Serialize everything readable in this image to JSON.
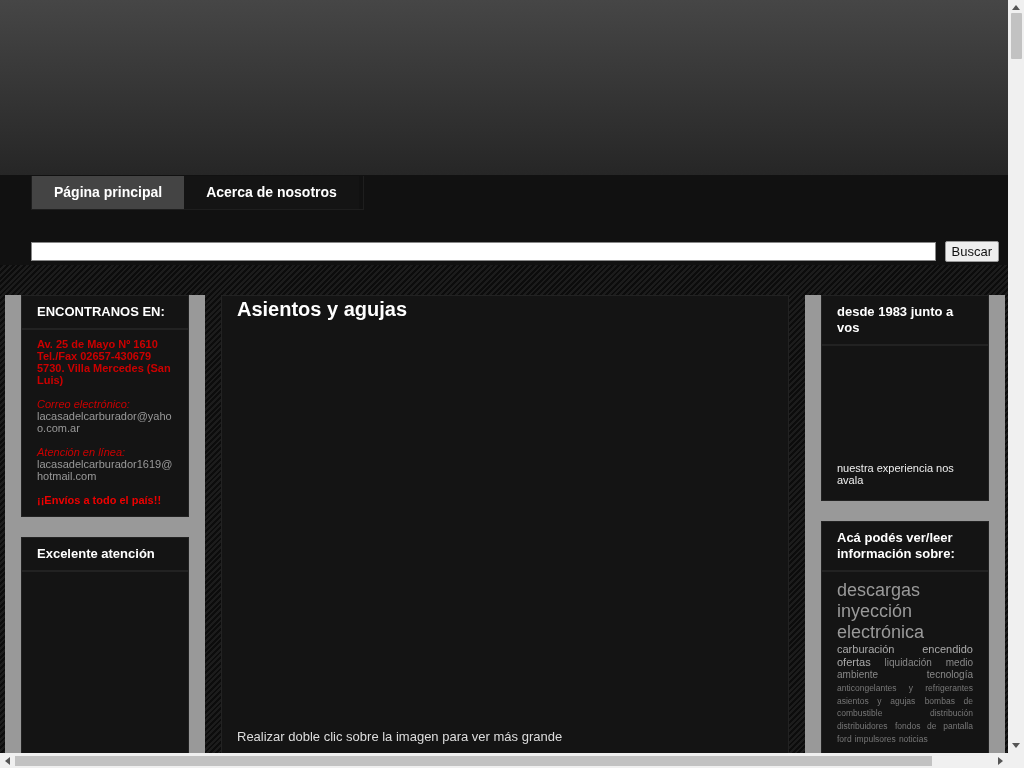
{
  "nav": {
    "tabs": [
      {
        "label": "Página principal",
        "selected": true
      },
      {
        "label": "Acerca de nosotros",
        "selected": false
      }
    ]
  },
  "search": {
    "button": "Buscar"
  },
  "left_sidebar": [
    {
      "title": "ENCONTRANOS EN:",
      "address": [
        "Av. 25 de Mayo Nº 1610",
        "Tel./Fax 02657-430679",
        "5730. Villa Mercedes (San Luis)"
      ],
      "fields": [
        {
          "label": "Correo electrónico:",
          "value": "lacasadelcarburador@yahoo.com.ar"
        },
        {
          "label": "Atención en línea:",
          "value": "lacasadelcarburador1619@hotmail.com"
        }
      ],
      "note": "¡¡Envíos a todo el país!!"
    },
    {
      "title": "Excelente atención"
    }
  ],
  "post": {
    "title": "Asientos y agujas",
    "caption": "Realizar doble clic sobre la imagen para ver más grande"
  },
  "right_sidebar": [
    {
      "title": "desde 1983 junto a vos",
      "caption": "nuestra experiencia nos avala"
    },
    {
      "title": "Acá podés ver/leer información sobre:",
      "tags": [
        {
          "text": "descargas",
          "kind": "large"
        },
        {
          "text": "inyección electrónica",
          "kind": "large"
        },
        {
          "text": "carburación",
          "kind": "medium"
        },
        {
          "text": "encendido",
          "kind": "medium"
        },
        {
          "text": "ofertas",
          "kind": "medium"
        },
        {
          "text": "liquidación",
          "kind": "small"
        },
        {
          "text": "medio ambiente",
          "kind": "small"
        },
        {
          "text": "tecnología",
          "kind": "small"
        },
        {
          "text": "anticongelantes y refrigerantes",
          "kind": "tiny"
        },
        {
          "text": "asientos y agujas",
          "kind": "tiny"
        },
        {
          "text": "bombas de combustible",
          "kind": "tiny"
        },
        {
          "text": "distribución",
          "kind": "tiny"
        },
        {
          "text": "distribuidores",
          "kind": "tiny"
        },
        {
          "text": "fondos de pantalla",
          "kind": "tiny"
        },
        {
          "text": "ford",
          "kind": "tiny"
        },
        {
          "text": "impulsores",
          "kind": "tiny"
        },
        {
          "text": "noticias",
          "kind": "tiny"
        }
      ]
    }
  ]
}
